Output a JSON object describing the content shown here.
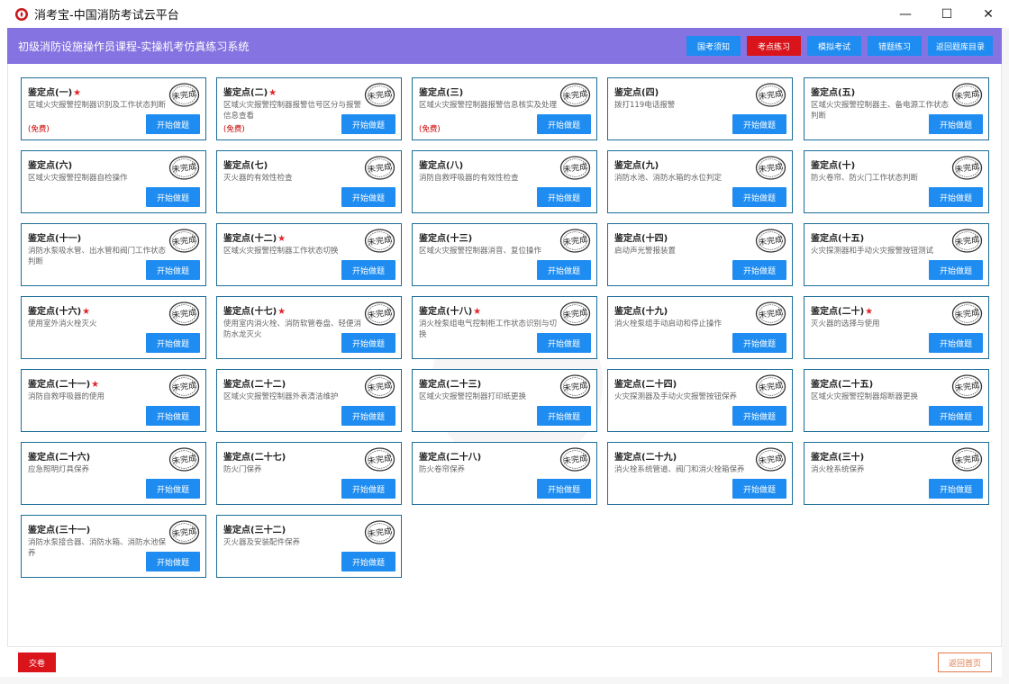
{
  "window": {
    "title": "消考宝-中国消防考试云平台",
    "minimize_glyph": "—",
    "maximize_glyph": "☐",
    "close_glyph": "✕"
  },
  "header": {
    "title": "初级消防设施操作员课程-实操机考仿真练习系统",
    "nav": [
      {
        "label": "国考须知",
        "active": false
      },
      {
        "label": "考点练习",
        "active": true
      },
      {
        "label": "模拟考试",
        "active": false
      },
      {
        "label": "错题练习",
        "active": false
      },
      {
        "label": "返回题库目录",
        "active": false
      }
    ]
  },
  "stamp_text": "未完成",
  "start_label": "开始做题",
  "cards": [
    {
      "title": "鉴定点(一)",
      "star": true,
      "desc": "区域火灾报警控制器识别及工作状态判断",
      "free": "(免费)"
    },
    {
      "title": "鉴定点(二)",
      "star": true,
      "desc": "区域火灾报警控制器报警信号区分与报警信息查看",
      "free": "(免费)"
    },
    {
      "title": "鉴定点(三)",
      "star": false,
      "desc": "区域火灾报警控制器报警信息核实及处理",
      "free": "(免费)"
    },
    {
      "title": "鉴定点(四)",
      "star": false,
      "desc": "拨打119电话报警",
      "free": ""
    },
    {
      "title": "鉴定点(五)",
      "star": false,
      "desc": "区域火灾报警控制器主、备电源工作状态判断",
      "free": ""
    },
    {
      "title": "鉴定点(六)",
      "star": false,
      "desc": "区域火灾报警控制器自检操作",
      "free": ""
    },
    {
      "title": "鉴定点(七)",
      "star": false,
      "desc": "灭火器的有效性检查",
      "free": ""
    },
    {
      "title": "鉴定点(八)",
      "star": false,
      "desc": "消防自救呼吸器的有效性检查",
      "free": ""
    },
    {
      "title": "鉴定点(九)",
      "star": false,
      "desc": "消防水池、消防水箱的水位判定",
      "free": ""
    },
    {
      "title": "鉴定点(十)",
      "star": false,
      "desc": "防火卷帘、防火门工作状态判断",
      "free": ""
    },
    {
      "title": "鉴定点(十一)",
      "star": false,
      "desc": "消防水泵吸水管、出水管和阀门工作状态判断",
      "free": ""
    },
    {
      "title": "鉴定点(十二)",
      "star": true,
      "desc": "区域火灾报警控制器工作状态切换",
      "free": ""
    },
    {
      "title": "鉴定点(十三)",
      "star": false,
      "desc": "区域火灾报警控制器消音、复位操作",
      "free": ""
    },
    {
      "title": "鉴定点(十四)",
      "star": false,
      "desc": "启动声光警报装置",
      "free": ""
    },
    {
      "title": "鉴定点(十五)",
      "star": false,
      "desc": "火灾探测器和手动火灾报警按钮测试",
      "free": ""
    },
    {
      "title": "鉴定点(十六)",
      "star": true,
      "desc": "使用室外消火栓灭火",
      "free": ""
    },
    {
      "title": "鉴定点(十七)",
      "star": true,
      "desc": "使用室内消火栓、消防软管卷盘、轻便消防水龙灭火",
      "free": ""
    },
    {
      "title": "鉴定点(十八)",
      "star": true,
      "desc": "消火栓泵组电气控制柜工作状态识别与切换",
      "free": ""
    },
    {
      "title": "鉴定点(十九)",
      "star": false,
      "desc": "消火栓泵组手动启动和停止操作",
      "free": ""
    },
    {
      "title": "鉴定点(二十)",
      "star": true,
      "desc": "灭火器的选择与使用",
      "free": ""
    },
    {
      "title": "鉴定点(二十一)",
      "star": true,
      "desc": "消防自救呼吸器的使用",
      "free": ""
    },
    {
      "title": "鉴定点(二十二)",
      "star": false,
      "desc": "区域火灾报警控制器外表清洁维护",
      "free": ""
    },
    {
      "title": "鉴定点(二十三)",
      "star": false,
      "desc": "区域火灾报警控制器打印纸更换",
      "free": ""
    },
    {
      "title": "鉴定点(二十四)",
      "star": false,
      "desc": "火灾探测器及手动火灾报警按钮保养",
      "free": ""
    },
    {
      "title": "鉴定点(二十五)",
      "star": false,
      "desc": "区域火灾报警控制器熔断器更换",
      "free": ""
    },
    {
      "title": "鉴定点(二十六)",
      "star": false,
      "desc": "应急照明灯具保养",
      "free": ""
    },
    {
      "title": "鉴定点(二十七)",
      "star": false,
      "desc": "防火门保养",
      "free": ""
    },
    {
      "title": "鉴定点(二十八)",
      "star": false,
      "desc": "防火卷帘保养",
      "free": ""
    },
    {
      "title": "鉴定点(二十九)",
      "star": false,
      "desc": "消火栓系统管道、阀门和消火栓箱保养",
      "free": ""
    },
    {
      "title": "鉴定点(三十)",
      "star": false,
      "desc": "消火栓系统保养",
      "free": ""
    },
    {
      "title": "鉴定点(三十一)",
      "star": false,
      "desc": "消防水泵接合器、消防水箱、消防水池保养",
      "free": ""
    },
    {
      "title": "鉴定点(三十二)",
      "star": false,
      "desc": "灭火器及安装配件保养",
      "free": ""
    }
  ],
  "footer": {
    "submit_label": "交卷",
    "home_label": "返回首页"
  },
  "colors": {
    "header_bg": "#8473e0",
    "primary_button": "#1e8cf0",
    "active_button": "#d9141b",
    "card_border": "#1b6d98",
    "home_button_border": "#e07b4a"
  }
}
